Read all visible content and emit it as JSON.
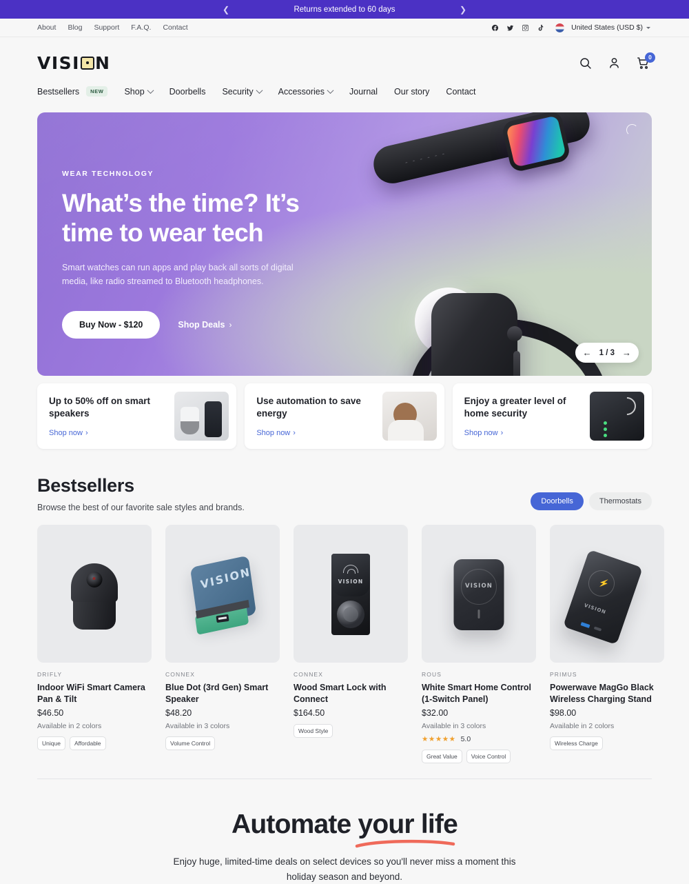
{
  "announcement": {
    "text": "Returns extended to 60 days",
    "prev_icon": "chevron-left-icon",
    "next_icon": "chevron-right-icon"
  },
  "utility": {
    "links": [
      "About",
      "Blog",
      "Support",
      "F.A.Q.",
      "Contact"
    ],
    "social": [
      "facebook-icon",
      "twitter-icon",
      "instagram-icon",
      "tiktok-icon"
    ],
    "country": "United States (USD $)"
  },
  "header": {
    "logo": "VISION",
    "icons": [
      "search-icon",
      "account-icon",
      "cart-icon"
    ],
    "cart_count": "0",
    "nav": [
      {
        "label": "Bestsellers",
        "badge": "NEW",
        "dropdown": false
      },
      {
        "label": "Shop",
        "dropdown": true
      },
      {
        "label": "Doorbells",
        "dropdown": false
      },
      {
        "label": "Security",
        "dropdown": true
      },
      {
        "label": "Accessories",
        "dropdown": true
      },
      {
        "label": "Journal",
        "dropdown": false
      },
      {
        "label": "Our story",
        "dropdown": false
      },
      {
        "label": "Contact",
        "dropdown": false
      }
    ]
  },
  "hero": {
    "eyebrow": "WEAR TECHNOLOGY",
    "title": "What’s the time? It’s time to wear tech",
    "subtitle": "Smart watches can run apps and play back all sorts of digital media, like radio streamed to Bluetooth headphones.",
    "primary_cta": "Buy Now - $120",
    "secondary_cta": "Shop Deals",
    "pager": "1 / 3",
    "prev_icon": "arrow-left-icon",
    "next_icon": "arrow-right-icon"
  },
  "promos": [
    {
      "title": "Up to 50% off on smart speakers",
      "link": "Shop now",
      "image": "smart-speakers-photo"
    },
    {
      "title": "Use automation to save energy",
      "link": "Shop now",
      "image": "woman-thermostat-photo"
    },
    {
      "title": "Enjoy a greater level of home security",
      "link": "Shop now",
      "image": "keypad-lock-photo"
    }
  ],
  "bestsellers": {
    "title": "Bestsellers",
    "subtitle": "Browse the best of our favorite sale styles and brands.",
    "filters": [
      {
        "label": "Doorbells",
        "active": true
      },
      {
        "label": "Thermostats",
        "active": false
      }
    ],
    "products": [
      {
        "brand": "DRIFLY",
        "name": "Indoor WiFi Smart Camera Pan & Tilt",
        "price": "$46.50",
        "colors": "Available in 2 colors",
        "rating": null,
        "rating_value": null,
        "tags": [
          "Unique",
          "Affordable"
        ],
        "image": "pan-tilt-camera"
      },
      {
        "brand": "CONNEX",
        "name": "Blue Dot (3rd Gen) Smart Speaker",
        "price": "$48.20",
        "colors": "Available in 3 colors",
        "rating": null,
        "rating_value": null,
        "tags": [
          "Volume Control"
        ],
        "image": "blue-cube-speaker"
      },
      {
        "brand": "CONNEX",
        "name": "Wood Smart Lock with Connect",
        "price": "$164.50",
        "colors": null,
        "rating": null,
        "rating_value": null,
        "tags": [
          "Wood Style"
        ],
        "image": "smart-lock"
      },
      {
        "brand": "ROUS",
        "name": "White Smart Home Control (1-Switch Panel)",
        "price": "$32.00",
        "colors": "Available in 3 colors",
        "rating": "★★★★★",
        "rating_value": "5.0",
        "tags": [
          "Great Value",
          "Voice Control"
        ],
        "image": "magsafe-control-panel"
      },
      {
        "brand": "PRIMUS",
        "name": "Powerwave MagGo Black Wireless Charging Stand",
        "price": "$98.00",
        "colors": "Available in 2 colors",
        "rating": null,
        "rating_value": null,
        "tags": [
          "Wireless Charge"
        ],
        "image": "power-bank"
      }
    ]
  },
  "automate": {
    "title_part1": "Automate ",
    "title_part2": "your life",
    "subtitle": "Enjoy huge, limited-time deals on select devices so you'll never miss a moment this holiday season and beyond.",
    "underline_color": "#ef6a5a"
  },
  "colors": {
    "announcement_bg": "#4b31c4",
    "accent_blue": "#4666d6",
    "page_bg": "#f7f7f7",
    "star": "#f0a02e"
  }
}
